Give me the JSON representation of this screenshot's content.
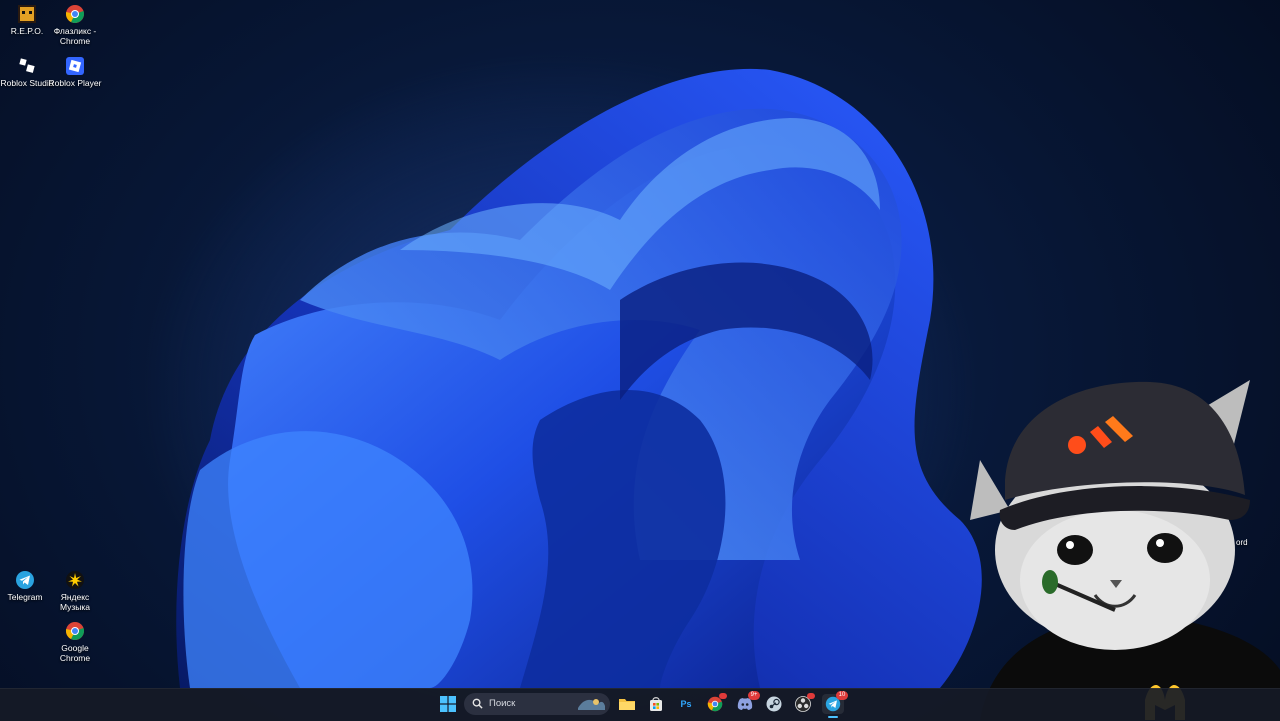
{
  "desktop": {
    "icons": [
      {
        "label": "R.E.P.O.",
        "icon": "repo-game-icon"
      },
      {
        "label": "Флазликс - Chrome",
        "icon": "chrome-icon"
      },
      {
        "label": "Roblox Studio",
        "icon": "roblox-studio-icon"
      },
      {
        "label": "Roblox Player",
        "icon": "roblox-player-icon"
      },
      {
        "label": "Telegram",
        "icon": "telegram-icon"
      },
      {
        "label": "Яндекс Музыка",
        "icon": "yandex-music-icon"
      },
      {
        "label": "Google Chrome",
        "icon": "chrome-icon"
      }
    ],
    "partial_label": "ord"
  },
  "taskbar": {
    "search_placeholder": "Поиск",
    "apps": [
      {
        "name": "start-button",
        "icon": "windows-logo-icon"
      },
      {
        "name": "file-explorer",
        "icon": "folder-icon"
      },
      {
        "name": "microsoft-store",
        "icon": "store-icon"
      },
      {
        "name": "photoshop",
        "icon": "photoshop-icon",
        "label": "Ps"
      },
      {
        "name": "chrome",
        "icon": "chrome-icon"
      },
      {
        "name": "discord",
        "icon": "discord-icon",
        "badge": "9+"
      },
      {
        "name": "steam",
        "icon": "steam-icon"
      },
      {
        "name": "obs",
        "icon": "obs-icon"
      },
      {
        "name": "telegram",
        "icon": "telegram-icon",
        "badge": "10"
      }
    ]
  },
  "colors": {
    "accent": "#3c6bff",
    "taskbar": "#161a26",
    "wallpaper_dark": "#040c1f"
  }
}
